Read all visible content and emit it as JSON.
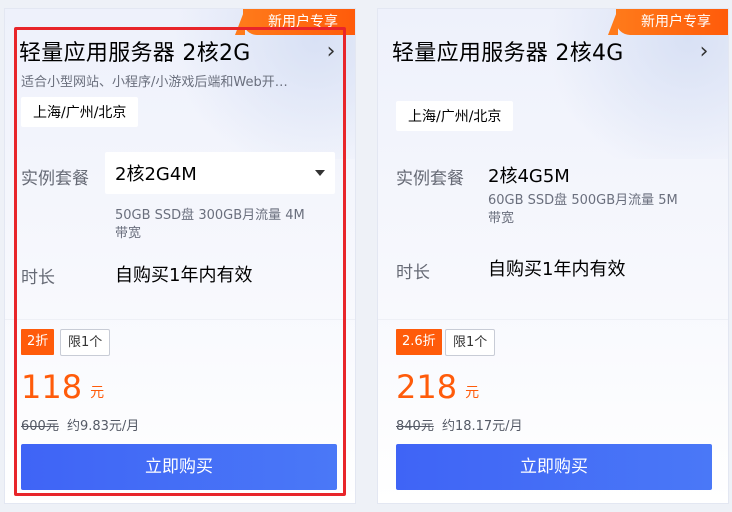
{
  "cards": [
    {
      "badge": "新用户专享",
      "title": "轻量应用服务器 2核2G",
      "description": "适合小型网站、小程序/小游戏后端和Web开…",
      "region": "上海/广州/北京",
      "plan_label": "实例套餐",
      "plan_value": "2核2G4M",
      "plan_spec": "50GB SSD盘 300GB月流量 4M\n带宽",
      "duration_label": "时长",
      "duration_value": "自购买1年内有效",
      "discount": "2折",
      "limit": "限1个",
      "price": "118",
      "price_unit": "元",
      "original_price": "600元",
      "monthly_price": "约9.83元/月",
      "buy_label": "立即购买"
    },
    {
      "badge": "新用户专享",
      "title": "轻量应用服务器 2核4G",
      "region": "上海/广州/北京",
      "plan_label": "实例套餐",
      "plan_value": "2核4G5M",
      "plan_spec": "60GB SSD盘 500GB月流量 5M\n带宽",
      "duration_label": "时长",
      "duration_value": "自购买1年内有效",
      "discount": "2.6折",
      "limit": "限1个",
      "price": "218",
      "price_unit": "元",
      "original_price": "840元",
      "monthly_price": "约18.17元/月",
      "buy_label": "立即购买"
    }
  ],
  "icons": {
    "chevron": "chevron-right-icon",
    "dropdown": "caret-down-icon"
  },
  "colors": {
    "accent_orange": "#ff5b0a",
    "button_blue": "#4a6ef6",
    "highlight_red": "#e8252a"
  }
}
